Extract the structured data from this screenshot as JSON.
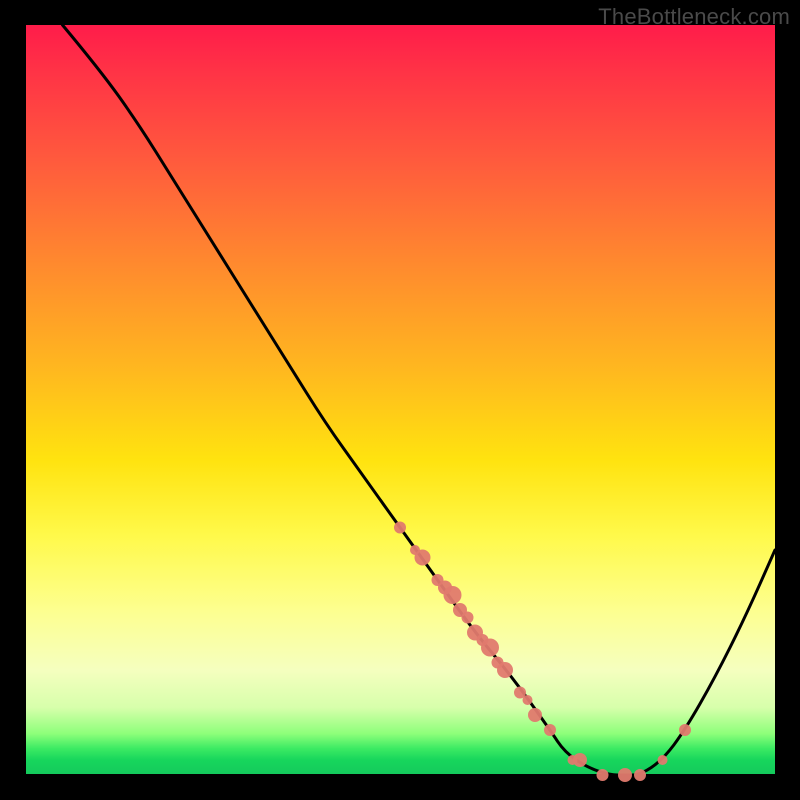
{
  "watermark": "TheBottleneck.com",
  "chart_data": {
    "type": "line",
    "title": "",
    "xlabel": "",
    "ylabel": "",
    "xlim": [
      0,
      100
    ],
    "ylim": [
      0,
      100
    ],
    "background": "red-yellow-green vertical gradient (red=high bottleneck, green=low)",
    "curve": {
      "description": "Bottleneck percentage vs component strength. Starts near 100% at x~5, descends roughly linearly to a trough ~0% around x~72-82, then rises to ~30% at x=100.",
      "x": [
        5,
        10,
        15,
        20,
        25,
        30,
        35,
        40,
        45,
        50,
        55,
        60,
        65,
        70,
        72,
        75,
        78,
        80,
        82,
        85,
        88,
        92,
        96,
        100
      ],
      "y": [
        100,
        94,
        87,
        79,
        71,
        63,
        55,
        47,
        40,
        33,
        26,
        19,
        13,
        6,
        3,
        1,
        0,
        0,
        0,
        2,
        6,
        13,
        21,
        30
      ]
    },
    "points": {
      "description": "Observed sample dots clustered on the descending limb (~x 50-70) and across the trough/rising limb (~x 70-90).",
      "x": [
        50,
        52,
        53,
        55,
        56,
        57,
        58,
        59,
        60,
        61,
        62,
        63,
        64,
        66,
        67,
        68,
        70,
        73,
        74,
        77,
        80,
        82,
        85,
        88
      ],
      "y": [
        33,
        30,
        29,
        26,
        25,
        24,
        22,
        21,
        19,
        18,
        17,
        15,
        14,
        11,
        10,
        8,
        6,
        2,
        2,
        0,
        0,
        0,
        2,
        6
      ],
      "r": [
        6,
        5,
        8,
        6,
        7,
        9,
        7,
        6,
        8,
        6,
        9,
        6,
        8,
        6,
        5,
        7,
        6,
        5,
        7,
        6,
        7,
        6,
        5,
        6
      ]
    },
    "colors": {
      "curve": "#000000",
      "points_fill": "#e07a6e",
      "points_stroke": "#e07a6e"
    }
  }
}
